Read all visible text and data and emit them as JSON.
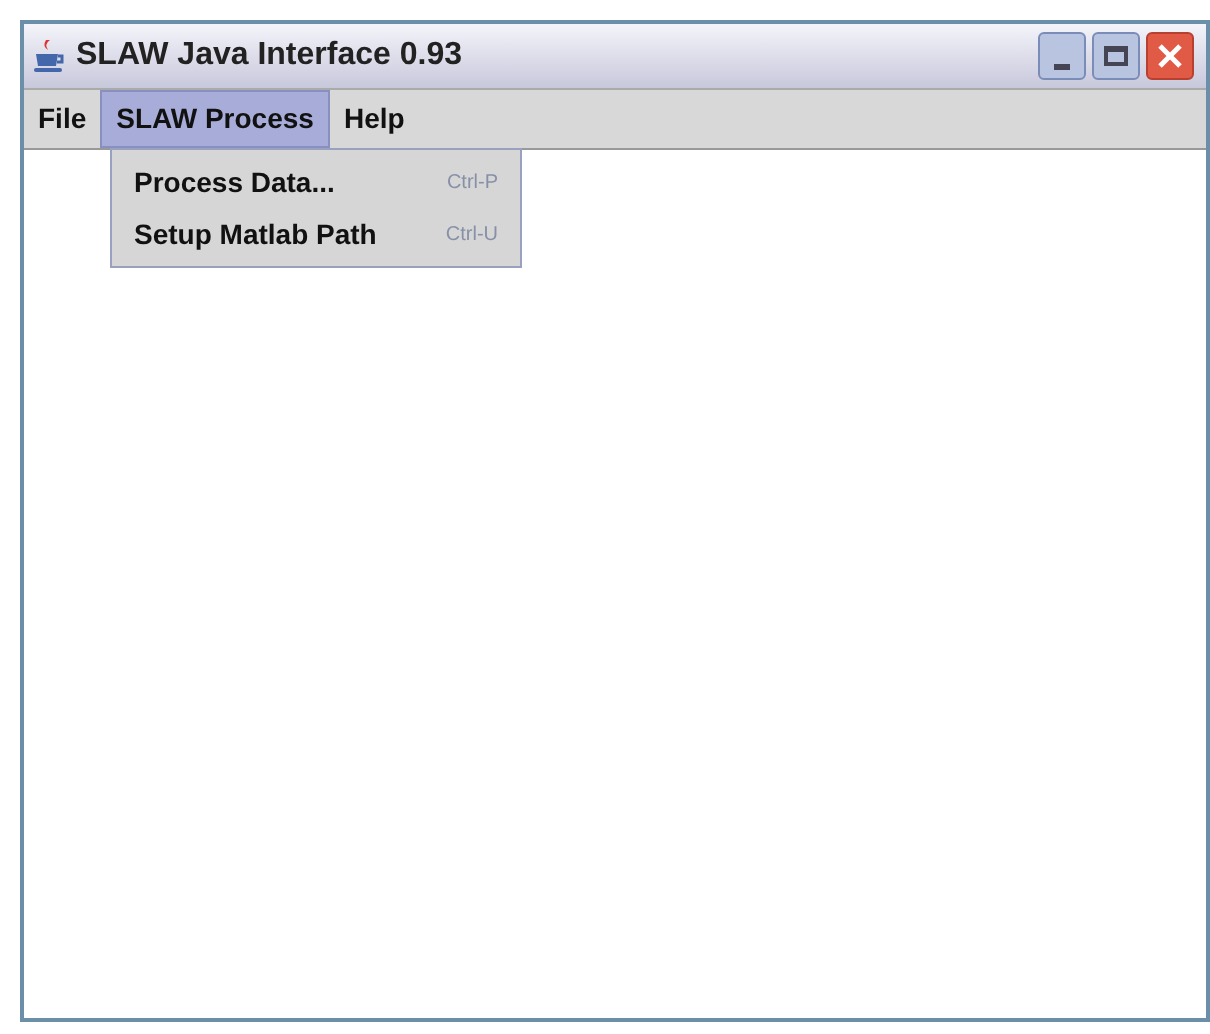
{
  "window": {
    "title": "SLAW Java Interface 0.93"
  },
  "menu_bar": [
    {
      "label": "File",
      "selected": false
    },
    {
      "label": "SLAW Process",
      "selected": true
    },
    {
      "label": "Help",
      "selected": false
    }
  ],
  "open_menu": {
    "items": [
      {
        "label": "Process Data...",
        "shortcut": "Ctrl-P"
      },
      {
        "label": "Setup Matlab Path",
        "shortcut": "Ctrl-U"
      }
    ]
  }
}
